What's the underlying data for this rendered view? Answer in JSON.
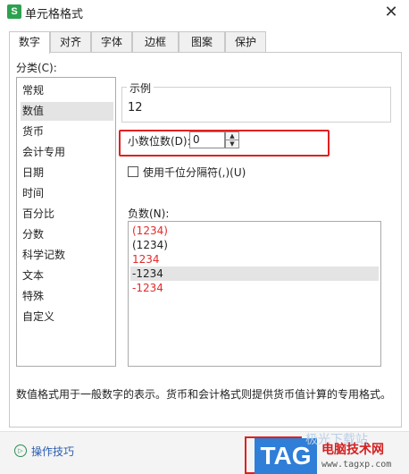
{
  "window": {
    "app_icon_letter": "S",
    "title": "单元格格式",
    "close_glyph": "✕"
  },
  "tabs": [
    {
      "label": "数字",
      "active": true
    },
    {
      "label": "对齐",
      "active": false
    },
    {
      "label": "字体",
      "active": false
    },
    {
      "label": "边框",
      "active": false
    },
    {
      "label": "图案",
      "active": false
    },
    {
      "label": "保护",
      "active": false
    }
  ],
  "category": {
    "label": "分类(C):",
    "items": [
      "常规",
      "数值",
      "货币",
      "会计专用",
      "日期",
      "时间",
      "百分比",
      "分数",
      "科学记数",
      "文本",
      "特殊",
      "自定义"
    ],
    "selected": "数值"
  },
  "sample": {
    "title": "示例",
    "value": "12"
  },
  "decimal_places": {
    "label": "小数位数(D):",
    "value": "0",
    "up_glyph": "▲",
    "down_glyph": "▼"
  },
  "thousands_separator": {
    "label": "使用千位分隔符(,)(U)",
    "checked": false
  },
  "negative_numbers": {
    "label": "负数(N):",
    "items": [
      {
        "text": "(1234)",
        "color": "#e32b2b"
      },
      {
        "text": "(1234)",
        "color": "#222222"
      },
      {
        "text": "1234",
        "color": "#e32b2b"
      },
      {
        "text": "-1234",
        "color": "#222222"
      },
      {
        "text": "-1234",
        "color": "#e32b2b"
      }
    ],
    "selected_index": 3
  },
  "description": "数值格式用于一般数字的表示。货币和会计格式则提供货币值计算的专用格式。",
  "footer": {
    "tips_icon": "play-circle-icon",
    "tips_glyph": "▷",
    "tips_label": "操作技巧"
  },
  "watermark": {
    "tag": "TAG",
    "faint": "极光下载站",
    "site": "电脑技术网",
    "url": "www.tagxp.com"
  },
  "colors": {
    "highlight_border": "#e02020",
    "selection_bg": "#e4e4e4",
    "negative_red": "#e32b2b",
    "link": "#2a5db0",
    "tag_blue": "#2f7ed8"
  }
}
